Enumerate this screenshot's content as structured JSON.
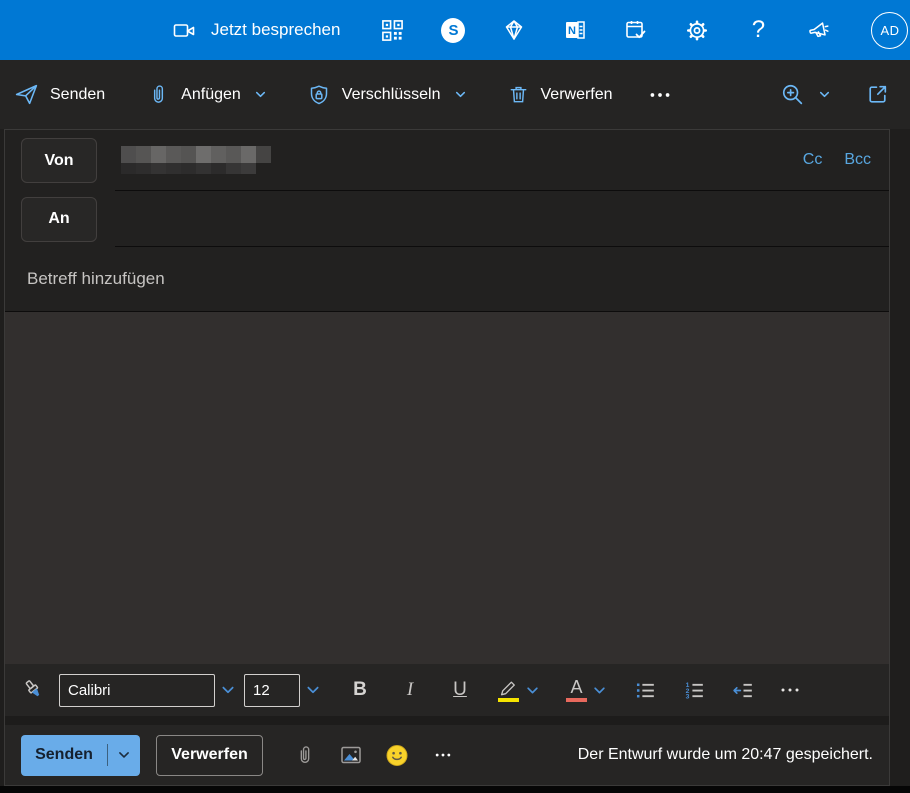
{
  "topbar": {
    "meet_now_label": "Jetzt besprechen",
    "avatar_initials": "AD",
    "icons": [
      "video-camera-icon",
      "qr-code-icon",
      "skype-icon",
      "premium-diamond-icon",
      "onenote-feed-icon",
      "my-day-calendar-icon",
      "settings-gear-icon",
      "help-icon",
      "feedback-megaphone-icon"
    ]
  },
  "glyphs": {
    "skype": "S",
    "onenote": "N",
    "help": "?",
    "n1": "1",
    "n2": "2",
    "n3": "3"
  },
  "toolbar": {
    "send_label": "Senden",
    "attach_label": "Anfügen",
    "encrypt_label": "Verschlüsseln",
    "discard_label": "Verwerfen",
    "icons": [
      "send-icon",
      "paperclip-icon",
      "shield-lock-icon",
      "trash-icon",
      "more-icon",
      "zoom-in-icon",
      "open-new-window-icon"
    ]
  },
  "compose": {
    "from_label": "Von",
    "to_label": "An",
    "cc_label": "Cc",
    "bcc_label": "Bcc",
    "subject_placeholder": "Betreff hinzufügen",
    "redacted_from_blocks": [
      [
        "#4f4e4e",
        "#565554",
        "#676665",
        "#5a5958",
        "#555453",
        "#6e6d6c",
        "#61605f",
        "#595857",
        "#6a6968",
        "#454443"
      ],
      [
        "#2b2a2a",
        "#2e2d2d",
        "#343333",
        "#302f2f",
        "#2d2c2c",
        "#333232",
        "#2c2b2b",
        "#363535",
        "#3c3b3b"
      ]
    ]
  },
  "format_bar": {
    "font_name": "Calibri",
    "font_size": "12",
    "bold": "B",
    "italic": "I",
    "underline": "U",
    "font_color_letter": "A",
    "icons": [
      "format-painter-icon",
      "highlighter-icon",
      "font-color-icon",
      "bullet-list-icon",
      "numbered-list-icon",
      "outdent-icon",
      "more-icon"
    ]
  },
  "footer": {
    "send_label": "Senden",
    "discard_label": "Verwerfen",
    "status_text": "Der Entwurf wurde um 20:47 gespeichert.",
    "icons": [
      "paperclip-icon",
      "insert-image-icon",
      "emoji-icon",
      "more-icon"
    ]
  },
  "colors": {
    "accent": "#0078d4",
    "toolbar_icon_blue": "#6cb8f6",
    "link_blue": "#58a6df",
    "highlight_yellow": "#f5e400",
    "font_color_red": "#e8695d",
    "send_button_blue": "#69ace9",
    "smiley_yellow": "#f8d22a"
  }
}
